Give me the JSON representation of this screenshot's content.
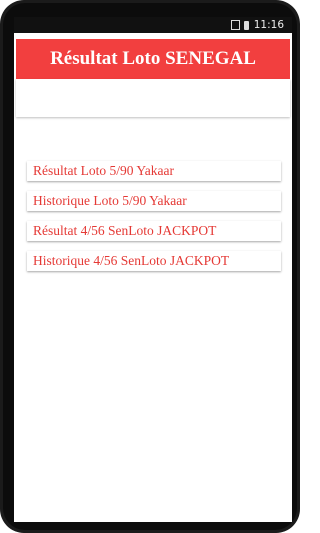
{
  "status_bar": {
    "time": "11:16",
    "icons": [
      "sim-icon",
      "battery-icon"
    ]
  },
  "app_bar": {
    "title": "Résultat Loto SENEGAL",
    "color": "#f23f3f"
  },
  "menu": {
    "items": [
      {
        "label": "Résultat Loto 5/90 Yakaar"
      },
      {
        "label": "Historique Loto 5/90 Yakaar"
      },
      {
        "label": "Résultat 4/56 SenLoto JACKPOT"
      },
      {
        "label": "Historique 4/56 SenLoto JACKPOT"
      }
    ],
    "text_color": "#e53935"
  }
}
